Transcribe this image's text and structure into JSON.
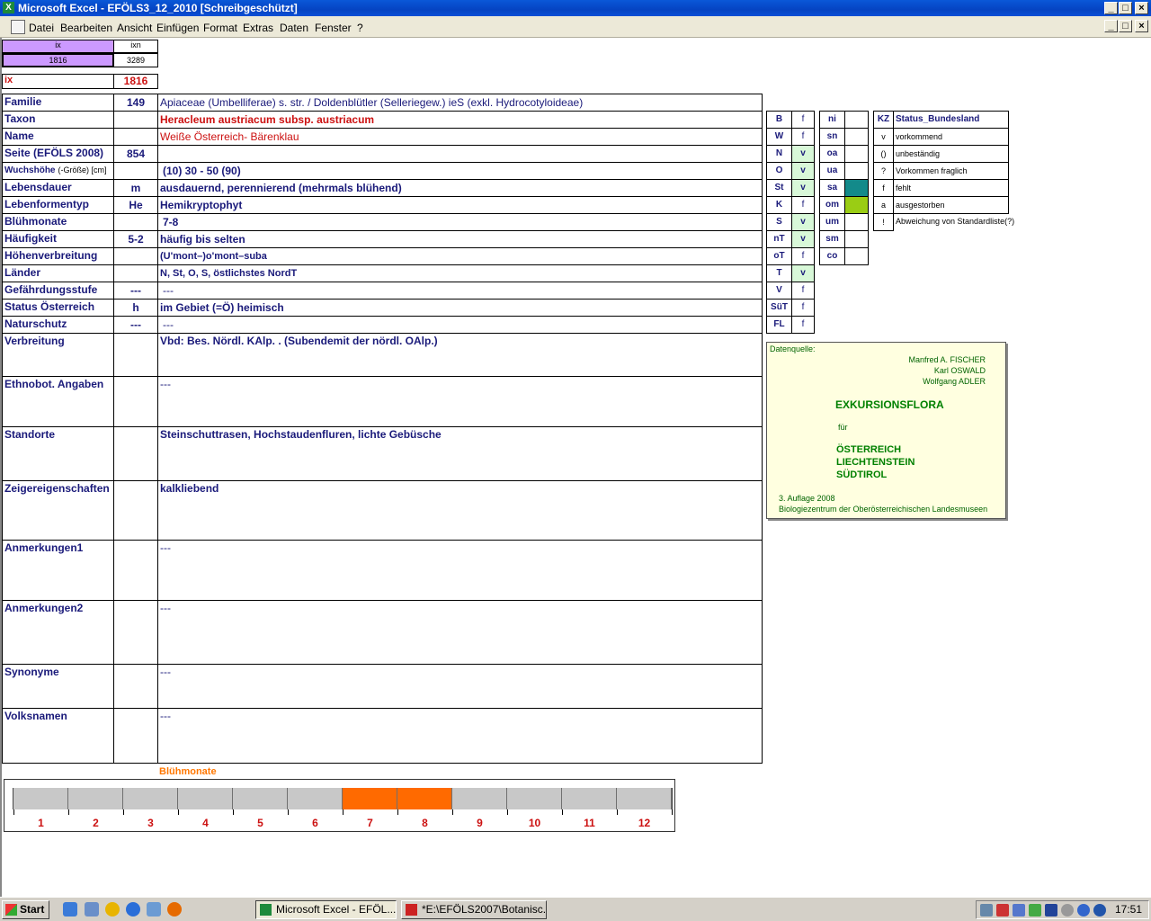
{
  "window": {
    "title": "Microsoft Excel - EFÖLS3_12_2010  [Schreibgeschützt]"
  },
  "menu": [
    "Datei",
    "Bearbeiten",
    "Ansicht",
    "Einfügen",
    "Format",
    "Extras",
    "Daten",
    "Fenster",
    "?"
  ],
  "top_cells": {
    "ix_head": "ix",
    "ixn_head": "ixn",
    "ix_val": "1816",
    "ixn_val": "3289",
    "ix_label": "ix",
    "ix_number": "1816"
  },
  "rows": [
    {
      "label": "Familie",
      "code": "149",
      "text": "Apiaceae (Umbelliferae) s. str.  /  Doldenblütler (Selleriegew.) ieS (exkl. Hydrocotyloideae)"
    },
    {
      "label": "Taxon",
      "code": "",
      "text": "Heracleum austriacum subsp. austriacum"
    },
    {
      "label": "Name",
      "code": "",
      "text": "Weiße Österreich- Bärenklau"
    },
    {
      "label": "Seite (EFÖLS 2008)",
      "code": "854",
      "text": ""
    },
    {
      "label": "Wuchshöhe",
      "label_small": "(-Größe) [cm]",
      "code": "",
      "text": "(10) 30 - 50 (90)"
    },
    {
      "label": "Lebensdauer",
      "code": "m",
      "text": "ausdauernd, perennierend (mehrmals blühend)"
    },
    {
      "label": "Lebenformentyp",
      "code": "He",
      "text": "Hemikryptophyt"
    },
    {
      "label": "Blühmonate",
      "code": "",
      "text": "7-8"
    },
    {
      "label": "Häufigkeit",
      "code": "5-2",
      "text": "häufig bis selten"
    },
    {
      "label": "Höhenverbreitung",
      "code": "",
      "text": "(U'mont–)o'mont–suba"
    },
    {
      "label": "Länder",
      "code": "",
      "text": "N, St, O, S, östlichstes NordT"
    },
    {
      "label": "Gefährdungsstufe",
      "code": "---",
      "text": "---"
    },
    {
      "label": "Status Österreich",
      "code": "h",
      "text": "im Gebiet (=Ö) heimisch"
    },
    {
      "label": "Naturschutz",
      "code": "---",
      "text": "---"
    },
    {
      "label": "Verbreitung",
      "code": "",
      "text": "Vbd: Bes. Nördl. KAlp. . (Subendemit der nördl. OAlp.)"
    },
    {
      "label": "Ethnobot. Angaben",
      "code": "",
      "text": "---"
    },
    {
      "label": "Standorte",
      "code": "",
      "text": "Steinschuttrasen, Hochstaudenfluren, lichte Gebüsche"
    },
    {
      "label": "Zeigereigenschaften",
      "code": "",
      "text": "kalkliebend"
    },
    {
      "label": "Anmerkungen1",
      "code": "",
      "text": "---"
    },
    {
      "label": "Anmerkungen2",
      "code": "",
      "text": "---"
    },
    {
      "label": "Synonyme",
      "code": "",
      "text": "---"
    },
    {
      "label": "Volksnamen",
      "code": "",
      "text": "---"
    }
  ],
  "states": [
    {
      "code": "B",
      "status": "f"
    },
    {
      "code": "W",
      "status": "f"
    },
    {
      "code": "N",
      "status": "v"
    },
    {
      "code": "O",
      "status": "v"
    },
    {
      "code": "St",
      "status": "v"
    },
    {
      "code": "K",
      "status": "f"
    },
    {
      "code": "S",
      "status": "v"
    },
    {
      "code": "nT",
      "status": "v"
    },
    {
      "code": "oT",
      "status": "f"
    },
    {
      "code": "T",
      "status": "v"
    },
    {
      "code": "V",
      "status": "f"
    },
    {
      "code": "SüT",
      "status": "f"
    },
    {
      "code": "FL",
      "status": "f"
    }
  ],
  "altitude": [
    {
      "code": "ni",
      "value": ""
    },
    {
      "code": "sn",
      "value": ""
    },
    {
      "code": "oa",
      "value": ""
    },
    {
      "code": "ua",
      "value": ""
    },
    {
      "code": "sa",
      "value": "",
      "color": "#138a8a"
    },
    {
      "code": "om",
      "value": "",
      "color": "#9acd14"
    },
    {
      "code": "um",
      "value": ""
    },
    {
      "code": "sm",
      "value": ""
    },
    {
      "code": "co",
      "value": ""
    }
  ],
  "legend": {
    "head_kz": "KZ",
    "head_status": "Status_Bundesland",
    "items": [
      {
        "kz": "v",
        "text": "vorkommend"
      },
      {
        "kz": "()",
        "text": "unbeständig"
      },
      {
        "kz": "?",
        "text": "Vorkommen fraglich"
      },
      {
        "kz": "f",
        "text": "fehlt"
      },
      {
        "kz": "a",
        "text": "ausgestorben"
      },
      {
        "kz": "!",
        "text": "Abweichung von Standardliste(?)"
      }
    ]
  },
  "source": {
    "label": "Datenquelle:",
    "authors": [
      "Manfred A. FISCHER",
      "Karl OSWALD",
      "Wolfgang ADLER"
    ],
    "book": "EXKURSIONSFLORA",
    "fuer": "für",
    "countries": [
      "ÖSTERREICH",
      "LIECHTENSTEIN",
      "SÜDTIROL"
    ],
    "edition": "3. Auflage 2008",
    "publisher": "Biologiezentrum der Oberösterreichischen Landesmuseen"
  },
  "months_chart": {
    "title": "Blühmonate",
    "months": [
      "1",
      "2",
      "3",
      "4",
      "5",
      "6",
      "7",
      "8",
      "9",
      "10",
      "11",
      "12"
    ],
    "active": [
      7,
      8
    ],
    "active_color": "#ff6a00"
  },
  "taskbar": {
    "start": "Start",
    "tasks": [
      "Microsoft Excel - EFÖL...",
      "*E:\\EFÖLS2007\\Botanisc..."
    ],
    "clock": "17:51"
  }
}
